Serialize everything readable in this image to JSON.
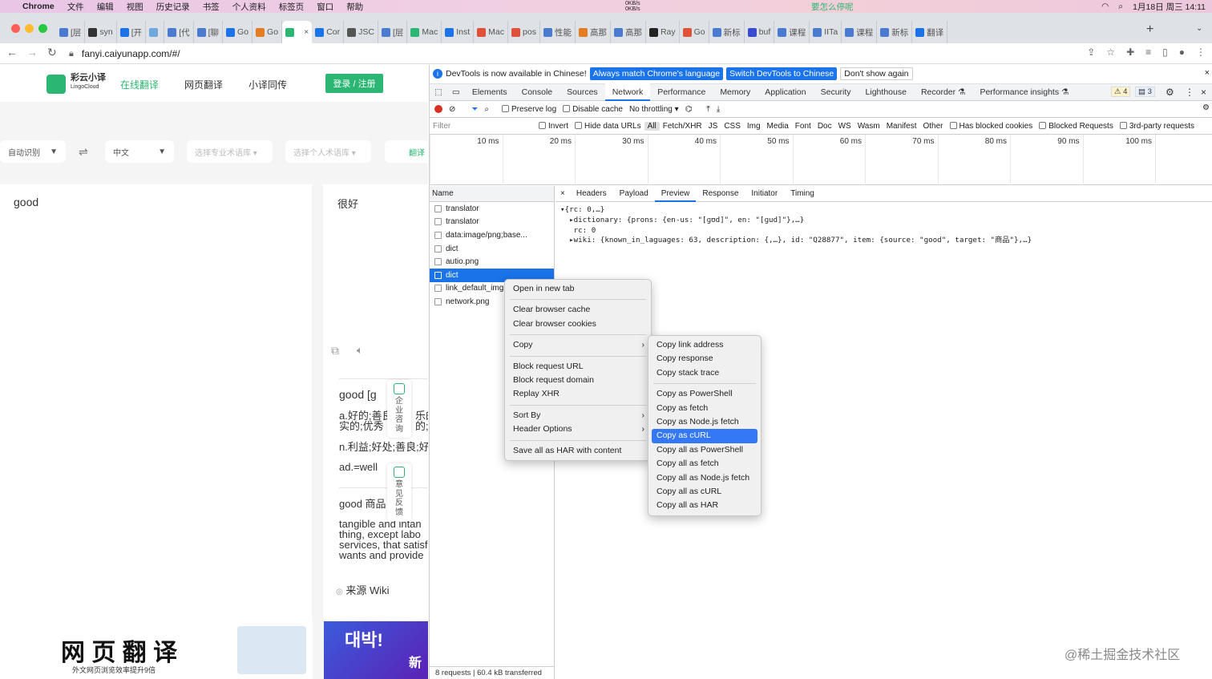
{
  "menubar": {
    "app": "Chrome",
    "items": [
      "文件",
      "编辑",
      "视图",
      "历史记录",
      "书签",
      "个人资料",
      "标签页",
      "窗口",
      "帮助"
    ],
    "net_up": "0KB/s",
    "net_down": "0KB/s",
    "center_text": "要怎么停呢",
    "datetime": "1月18日 周三  14:11"
  },
  "tabs": [
    {
      "label": "[层",
      "color": "#4a7bd0"
    },
    {
      "label": "syn",
      "color": "#333333"
    },
    {
      "label": "[开",
      "color": "#1a73e8"
    },
    {
      "label": "",
      "color": "#6fa8dc"
    },
    {
      "label": "[代",
      "color": "#4a7bd0"
    },
    {
      "label": "[聊",
      "color": "#4a7bd0"
    },
    {
      "label": "Go",
      "color": "#1a73e8"
    },
    {
      "label": "Go",
      "color": "#e67c22"
    },
    {
      "label": "",
      "color": "#2bb673"
    },
    {
      "label": "Cor",
      "color": "#1a73e8"
    },
    {
      "label": "JSC",
      "color": "#555555"
    },
    {
      "label": "[层",
      "color": "#4a7bd0"
    },
    {
      "label": "Mac",
      "color": "#2bb673"
    },
    {
      "label": "Inst",
      "color": "#1a73e8"
    },
    {
      "label": "Mac",
      "color": "#e0513a"
    },
    {
      "label": "pos",
      "color": "#e0513a"
    },
    {
      "label": "性能",
      "color": "#4a7bd0"
    },
    {
      "label": "高那",
      "color": "#e67c22"
    },
    {
      "label": "高那",
      "color": "#4a7bd0"
    },
    {
      "label": "Ray",
      "color": "#222222"
    },
    {
      "label": "Go",
      "color": "#e0513a"
    },
    {
      "label": "新标",
      "color": "#4a7bd0"
    },
    {
      "label": "buf",
      "color": "#3b4bd0"
    },
    {
      "label": "课程",
      "color": "#4a7bd0"
    },
    {
      "label": "IITa",
      "color": "#4a7bd0"
    },
    {
      "label": "课程",
      "color": "#4a7bd0"
    },
    {
      "label": "新标",
      "color": "#4a7bd0"
    },
    {
      "label": "翻译",
      "color": "#1a73e8"
    }
  ],
  "address": {
    "url": "fanyi.caiyunapp.com/#/"
  },
  "site": {
    "logo_cn": "彩云小译",
    "logo_en": "LingoCloud",
    "nav": [
      "在线翻译",
      "网页翻译",
      "小译同传"
    ],
    "login": "登录 / 注册",
    "src_lang": "自动识别",
    "tgt_lang": "中文",
    "pro_lib": "选择专业术语库 ▾",
    "personal_lib": "选择个人术语库 ▾",
    "translate_btn": "翻译",
    "source_text": "good",
    "target_text": "很好",
    "dict_word": "good",
    "dict_phon": "[ɡ",
    "dict_lines": [
      "a.好的;善良",
      "实的;优秀",
      "n.利益;好处;善良;好",
      "ad.=well"
    ],
    "dict_line1b": "乐的",
    "dict_line2b": "的;",
    "wiki_head": "good 商品",
    "wiki_lines": [
      "tangible and intan",
      "thing, except labo",
      "services, that satisf",
      "wants and provide"
    ],
    "wiki_source": "来源 Wiki",
    "float_consult": [
      "企",
      "业",
      "咨",
      "询"
    ],
    "float_feedback": [
      "意",
      "见",
      "反",
      "馈"
    ],
    "banner_title": "网 页 翻 译",
    "banner_sub": "外文网页浏览效率提升9倍",
    "banner2_text": "대박!",
    "banner2_sub": "新"
  },
  "devtools": {
    "banner_text": "DevTools is now available in Chinese!",
    "btn_match": "Always match Chrome's language",
    "btn_switch": "Switch DevTools to Chinese",
    "btn_dont": "Don't show again",
    "tabs": [
      "Elements",
      "Console",
      "Sources",
      "Network",
      "Performance",
      "Memory",
      "Application",
      "Security",
      "Lighthouse",
      "Recorder ⚗",
      "Performance insights ⚗"
    ],
    "active_tab": "Network",
    "warn_count": "4",
    "msg_count": "3",
    "preserve_log": "Preserve log",
    "disable_cache": "Disable cache",
    "throttling": "No throttling",
    "filter_placeholder": "Filter",
    "filter_opts": [
      "Invert",
      "Hide data URLs"
    ],
    "filter_types": [
      "All",
      "Fetch/XHR",
      "JS",
      "CSS",
      "Img",
      "Media",
      "Font",
      "Doc",
      "WS",
      "Wasm",
      "Manifest",
      "Other"
    ],
    "filter_checks": [
      "Has blocked cookies",
      "Blocked Requests",
      "3rd-party requests"
    ],
    "ticks": [
      "10 ms",
      "20 ms",
      "30 ms",
      "40 ms",
      "50 ms",
      "60 ms",
      "70 ms",
      "80 ms",
      "90 ms",
      "100 ms",
      "110"
    ],
    "name_header": "Name",
    "requests": [
      "translator",
      "translator",
      "data:image/png;base...",
      "dict",
      "autio.png",
      "dict",
      "link_default_img.p",
      "network.png"
    ],
    "footer": "8 requests  |  60.4 kB transferred",
    "detail_tabs": [
      "Headers",
      "Payload",
      "Preview",
      "Response",
      "Initiator",
      "Timing"
    ],
    "active_detail": "Preview",
    "json_lines": [
      "▾{rc: 0,…}",
      "  ▸dictionary: {prons: {en-us: \"[ɡʊd]\", en: \"[ɡud]\"},…}",
      "   rc: 0",
      "  ▸wiki: {known_in_laguages: 63, description: {,…}, id: \"Q28877\", item: {source: \"good\", target: \"商品\"},…}"
    ]
  },
  "context_menu": {
    "groups": [
      [
        "Open in new tab"
      ],
      [
        "Clear browser cache",
        "Clear browser cookies"
      ],
      [
        "Copy"
      ],
      [
        "Block request URL",
        "Block request domain",
        "Replay XHR"
      ],
      [
        "Sort By",
        "Header Options"
      ],
      [
        "Save all as HAR with content"
      ]
    ]
  },
  "copy_submenu": {
    "groups": [
      [
        "Copy link address",
        "Copy response",
        "Copy stack trace"
      ],
      [
        "Copy as PowerShell",
        "Copy as fetch",
        "Copy as Node.js fetch",
        "Copy as cURL",
        "Copy all as PowerShell",
        "Copy all as fetch",
        "Copy all as Node.js fetch",
        "Copy all as cURL",
        "Copy all as HAR"
      ]
    ],
    "highlighted": "Copy as cURL"
  },
  "watermark": "@稀土掘金技术社区"
}
